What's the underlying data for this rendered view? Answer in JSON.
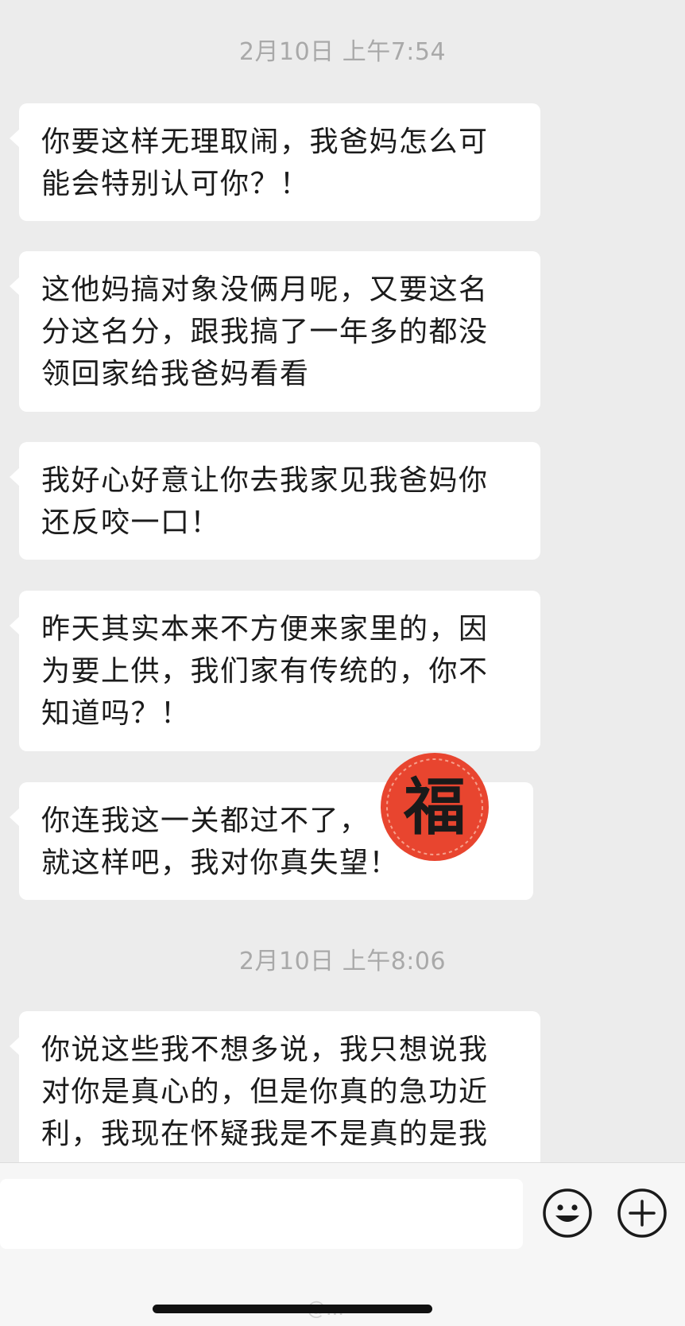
{
  "timestamps": [
    "2月10日 上午7:54",
    "2月10日 上午8:06"
  ],
  "messages": [
    {
      "lines": [
        "你要这样无理取闹，我爸妈怎么可",
        "能会特别认可你？！"
      ]
    },
    {
      "lines": [
        "这他妈搞对象没俩月呢，又要这名",
        "分这名分，跟我搞了一年多的都没",
        "领回家给我爸妈看看"
      ]
    },
    {
      "lines": [
        "我好心好意让你去我家见我爸妈你",
        "还反咬一口！"
      ]
    },
    {
      "lines": [
        "昨天其实本来不方便来家里的，因",
        "为要上供，我们家有传统的，你不",
        "知道吗？！"
      ]
    },
    {
      "lines": [
        "你连我这一关都过不了，",
        "就这样吧，我对你真失望！"
      ]
    },
    {
      "lines": [
        "你说这些我不想多说，我只想说我",
        "对你是真心的，但是你真的急功近",
        "利，我现在怀疑我是不是真的是我"
      ]
    }
  ],
  "sticker": {
    "label": "福",
    "color": "#e8452f"
  },
  "input_bar": {
    "input_value": "",
    "emoji_icon": "smiley-face-icon",
    "plus_icon": "plus-circle-icon"
  },
  "watermark": "@..."
}
